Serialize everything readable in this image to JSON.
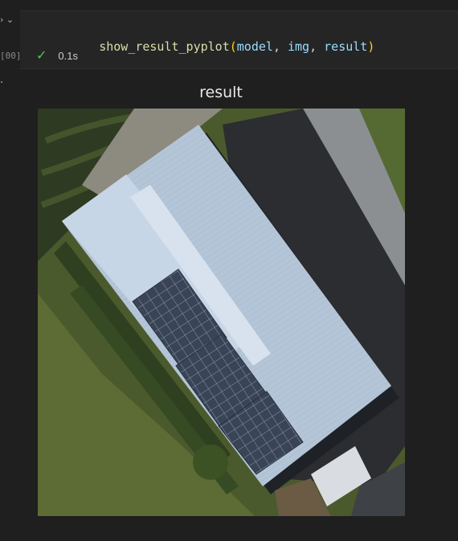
{
  "cell": {
    "code": {
      "function": "show_result_pyplot",
      "open_paren": "(",
      "arg1": "model",
      "arg2": "img",
      "arg3": "result",
      "close_paren": ")",
      "comma": ","
    },
    "execution_count": "[00]",
    "status": {
      "icon": "check-icon",
      "duration": "0.1s"
    }
  },
  "output": {
    "marker": ".",
    "title": "result",
    "image": {
      "description_icon": "aerial-image",
      "colors": {
        "grass": "#4a5a2a",
        "hedge": "#2f3d22",
        "roof": "#b9c9dc",
        "roof_shadow": "#8fa2b8",
        "panels": "#3c4658",
        "road": "#8b8f92",
        "parking": "#2b2d30"
      }
    }
  },
  "theme": {
    "background": "#1f1f1f",
    "cell_background": "#252526",
    "function_color": "#dcdcaa",
    "variable_color": "#9cdcfe",
    "paren_color": "#ffd700",
    "check_color": "#4ec94e"
  }
}
